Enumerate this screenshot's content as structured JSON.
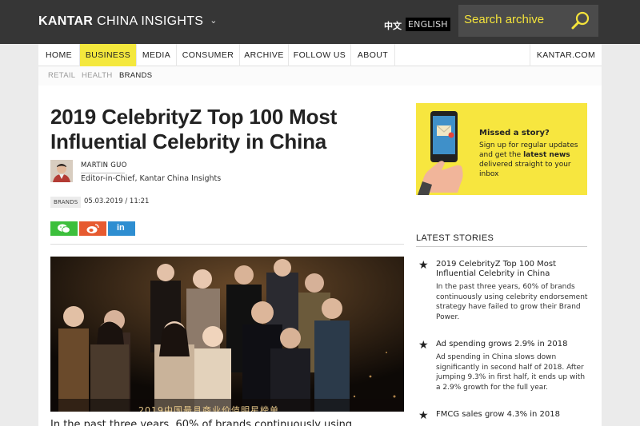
{
  "header": {
    "brand_bold": "KANTAR",
    "brand_rest": "CHINA INSIGHTS",
    "lang_cn": "中文",
    "lang_en": "ENGLISH",
    "search_placeholder": "Search archive"
  },
  "nav": {
    "items": [
      {
        "label": "HOME"
      },
      {
        "label": "BUSINESS"
      },
      {
        "label": "MEDIA"
      },
      {
        "label": "CONSUMER"
      },
      {
        "label": "ARCHIVE"
      },
      {
        "label": "FOLLOW US"
      },
      {
        "label": "ABOUT"
      }
    ],
    "right_link": "KANTAR.COM",
    "sub": [
      {
        "label": "RETAIL"
      },
      {
        "label": "HEALTH"
      },
      {
        "label": "BRANDS"
      }
    ]
  },
  "article": {
    "title": "2019 CelebrityZ Top 100 Most Influential Celebrity in China",
    "author_name": "MARTIN GUO",
    "author_role": "Editor-in-Chief, Kantar China Insights",
    "tag": "BRANDS",
    "date": "05.03.2019 / 11:21",
    "share": {
      "linkedin": "in"
    },
    "hero_caption": "2019中国最具商业价值明星榜单",
    "intro": "In the past three years, 60% of brands continuously using"
  },
  "sidebar": {
    "promo_title": "Missed a story?",
    "promo_pre": "Sign up for regular updates and get the ",
    "promo_bold": "latest news",
    "promo_post": " delivered straight to your inbox",
    "latest_heading": "LATEST STORIES",
    "stories": [
      {
        "title": "2019 CelebrityZ Top 100 Most Influential Celebrity in China",
        "summary": "In the past three years, 60% of brands continuously using celebrity endorsement strategy have failed to grow their Brand Power."
      },
      {
        "title": "Ad spending grows 2.9% in 2018",
        "summary": "Ad spending in China slows down significantly in second half of 2018. After jumping 9.3% in first half, it ends up with a 2.9% growth for the full year."
      },
      {
        "title": "FMCG sales grow 4.3% in 2018",
        "summary": ""
      }
    ]
  }
}
